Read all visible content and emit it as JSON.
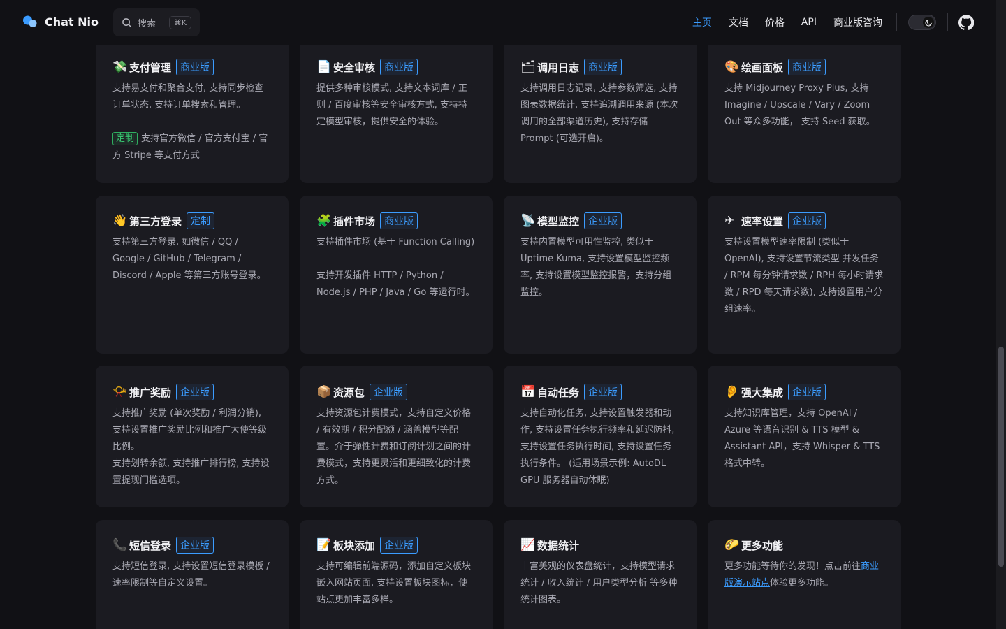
{
  "app": {
    "name": "Chat Nio"
  },
  "search": {
    "placeholder": "搜索",
    "shortcut": "⌘K"
  },
  "nav": {
    "home": "主页",
    "docs": "文档",
    "pricing": "价格",
    "api": "API",
    "enterprise": "商业版咨询"
  },
  "colors": {
    "accent": "#3b9cff",
    "custom_badge": "#37c46f",
    "card_bg": "#1b1b21",
    "page_bg": "#111115"
  },
  "cards": [
    {
      "emoji": "💸",
      "title": "支付管理",
      "badge": "商业版",
      "text1": "支持易支付和聚合支付, 支持同步检查订单状态, 支持订单搜索和管理。",
      "extra_badge": "定制",
      "extra_text": "支持官方微信 / 官方支付宝 / 官方 Stripe 等支付方式"
    },
    {
      "emoji": "📄",
      "title": "安全审核",
      "badge": "商业版",
      "text1": "提供多种审核模式, 支持文本词库 / 正则 / 百度审核等安全审核方式, 支持持定模型审核，提供安全的体验。"
    },
    {
      "emoji": "🗂",
      "title": "调用日志",
      "badge": "商业版",
      "text1": "支持调用日志记录, 支持参数筛选, 支持图表数据统计, 支持追溯调用来源 (本次调用的全部渠道历史), 支持存储 Prompt (可选开启)。"
    },
    {
      "emoji": "🎨",
      "title": "绘画面板",
      "badge": "商业版",
      "text1": "支持 Midjourney Proxy Plus, 支持 Imagine / Upscale / Vary / Zoom Out 等众多功能， 支持 Seed 获取。"
    },
    {
      "emoji": "👋",
      "title": "第三方登录",
      "badge": "定制",
      "text1": "支持第三方登录, 如微信 / QQ / Google / GitHub / Telegram / Discord / Apple 等第三方账号登录。"
    },
    {
      "emoji": "🧩",
      "title": "插件市场",
      "badge": "商业版",
      "text1": "支持插件市场 (基于 Function Calling)",
      "text2": "支持开发插件 HTTP / Python / Node.js / PHP / Java / Go 等运行时。"
    },
    {
      "emoji": "📡",
      "title": "模型监控",
      "badge": "企业版",
      "text1": "支持内置模型可用性监控, 类似于 Uptime Kuma, 支持设置模型监控频率, 支持设置模型监控报警，支持分组监控。"
    },
    {
      "emoji": "✈",
      "title": "速率设置",
      "badge": "企业版",
      "text1": "支持设置模型速率限制 (类似于 OpenAI), 支持设置节流类型 并发任务 / RPM 每分钟请求数 / RPH 每小时请求数 / RPD 每天请求数), 支持设置用户分组速率。"
    },
    {
      "emoji": "📯",
      "title": "推广奖励",
      "badge": "企业版",
      "text1": "支持推广奖励 (单次奖励 / 利润分销), 支持设置推广奖励比例和推广大使等级比例。",
      "text2": "支持划转余额, 支持推广排行榜, 支持设置提现门槛选项。"
    },
    {
      "emoji": "📦",
      "title": "资源包",
      "badge": "企业版",
      "text1": "支持资源包计费模式，支持自定义价格 / 有效期 / 积分配额 / 涵盖模型等配置。介于弹性计费和订阅计划之间的计费模式，支持更灵活和更细致化的计费方式。"
    },
    {
      "emoji": "📅",
      "title": "自动任务",
      "badge": "企业版",
      "text1": "支持自动化任务, 支持设置触发器和动作, 支持设置任务执行频率和延迟防抖, 支持设置任务执行时间, 支持设置任务执行条件。 (适用场景示例: AutoDL GPU 服务器自动休眠)"
    },
    {
      "emoji": "👂",
      "title": "强大集成",
      "badge": "企业版",
      "text1": "支持知识库管理，支持 OpenAI / Azure 等语音识别 & TTS 模型 & Assistant API，支持 Whisper & TTS 格式中转。"
    },
    {
      "emoji": "📞",
      "title": "短信登录",
      "badge": "企业版",
      "text1": "支持短信登录, 支持设置短信登录模板 / 速率限制等自定义设置。"
    },
    {
      "emoji": "📝",
      "title": "板块添加",
      "badge": "企业版",
      "text1": "支持可编辑前端源码，添加自定义板块嵌入网站页面, 支持设置板块图标，使站点更加丰富多样。"
    },
    {
      "emoji": "📈",
      "title": "数据统计",
      "text1": "丰富美观的仪表盘统计，支持模型请求统计 / 收入统计 / 用户类型分析 等多种统计图表。"
    },
    {
      "emoji": "🌮",
      "title": "更多功能",
      "text1": "更多功能等待你的发现！点击前往",
      "link": "商业版演示站点",
      "text_after": "体验更多功能。"
    }
  ]
}
